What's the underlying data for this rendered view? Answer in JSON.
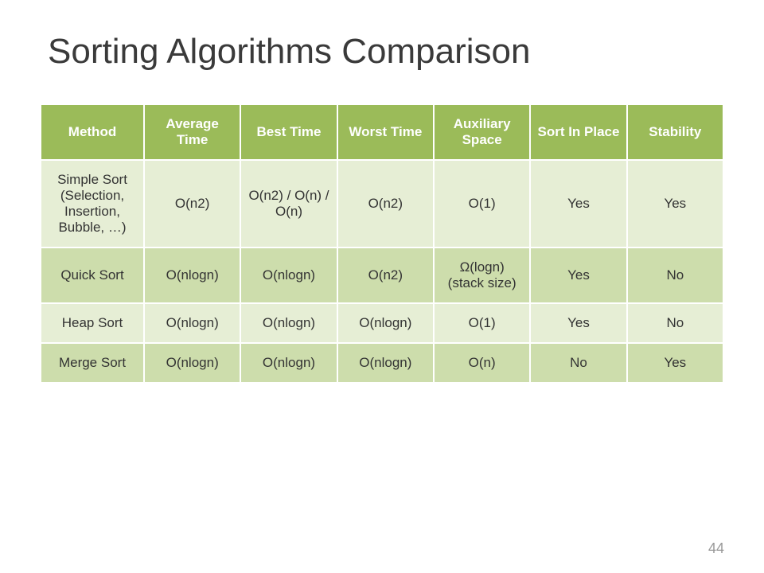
{
  "title": "Sorting Algorithms Comparison",
  "headers": [
    "Method",
    "Average Time",
    "Best Time",
    "Worst Time",
    "Auxiliary Space",
    "Sort In Place",
    "Stability"
  ],
  "rows": [
    {
      "method": "Simple Sort (Selection, Insertion, Bubble, …)",
      "avg": "O(n2)",
      "best": "O(n2) / O(n) / O(n)",
      "worst": "O(n2)",
      "aux": "O(1)",
      "inplace": "Yes",
      "stability": "Yes"
    },
    {
      "method": "Quick Sort",
      "avg": "O(nlogn)",
      "best": "O(nlogn)",
      "worst": "O(n2)",
      "aux": "Ω(logn) (stack size)",
      "inplace": "Yes",
      "stability": "No"
    },
    {
      "method": "Heap Sort",
      "avg": "O(nlogn)",
      "best": "O(nlogn)",
      "worst": "O(nlogn)",
      "aux": "O(1)",
      "inplace": "Yes",
      "stability": "No"
    },
    {
      "method": "Merge Sort",
      "avg": "O(nlogn)",
      "best": "O(nlogn)",
      "worst": "O(nlogn)",
      "aux": "O(n)",
      "inplace": "No",
      "stability": "Yes"
    }
  ],
  "page_number": "44",
  "chart_data": {
    "type": "table",
    "title": "Sorting Algorithms Comparison",
    "columns": [
      "Method",
      "Average Time",
      "Best Time",
      "Worst Time",
      "Auxiliary Space",
      "Sort In Place",
      "Stability"
    ],
    "data": [
      [
        "Simple Sort (Selection, Insertion, Bubble, …)",
        "O(n^2)",
        "O(n^2) / O(n) / O(n)",
        "O(n^2)",
        "O(1)",
        "Yes",
        "Yes"
      ],
      [
        "Quick Sort",
        "O(n log n)",
        "O(n log n)",
        "O(n^2)",
        "Ω(log n) (stack size)",
        "Yes",
        "No"
      ],
      [
        "Heap Sort",
        "O(n log n)",
        "O(n log n)",
        "O(n log n)",
        "O(1)",
        "Yes",
        "No"
      ],
      [
        "Merge Sort",
        "O(n log n)",
        "O(n log n)",
        "O(n log n)",
        "O(n)",
        "No",
        "Yes"
      ]
    ]
  }
}
